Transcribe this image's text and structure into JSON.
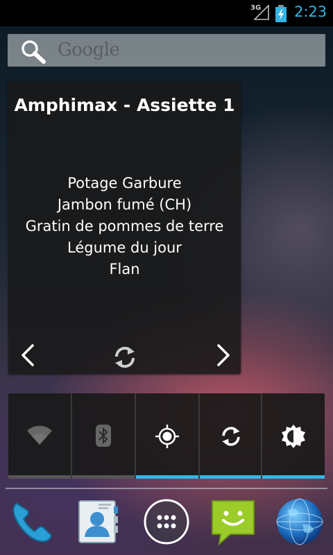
{
  "status_bar": {
    "network_type": "3G",
    "time": "2:23",
    "signal_icon": "signal-icon",
    "battery_icon": "battery-charging-icon",
    "accent_color": "#33b5e5"
  },
  "search": {
    "label": "Google",
    "icon": "search-icon"
  },
  "menu_widget": {
    "title": "Amphimax - Assiette 1",
    "items": [
      "Potage Garbure",
      "Jambon fumé (CH)",
      "Gratin de pommes de terre",
      "Légume du jour",
      "Flan"
    ],
    "controls": [
      "chevron-left-icon",
      "refresh-icon",
      "chevron-right-icon"
    ]
  },
  "power_widget": {
    "toggles": [
      {
        "name": "wifi",
        "icon": "wifi-icon",
        "active": false
      },
      {
        "name": "bluetooth",
        "icon": "bluetooth-icon",
        "active": false
      },
      {
        "name": "gps",
        "icon": "gps-icon",
        "active": true
      },
      {
        "name": "sync",
        "icon": "sync-icon",
        "active": true
      },
      {
        "name": "brightness",
        "icon": "brightness-icon",
        "active": true
      }
    ],
    "active_color": "#33b5e5",
    "inactive_color": "#555555"
  },
  "dock": {
    "items": [
      {
        "name": "phone",
        "icon": "phone-icon"
      },
      {
        "name": "contacts",
        "icon": "contacts-icon"
      },
      {
        "name": "all-apps",
        "icon": "app-drawer-icon"
      },
      {
        "name": "messaging",
        "icon": "messaging-icon"
      },
      {
        "name": "browser",
        "icon": "globe-icon"
      }
    ]
  }
}
